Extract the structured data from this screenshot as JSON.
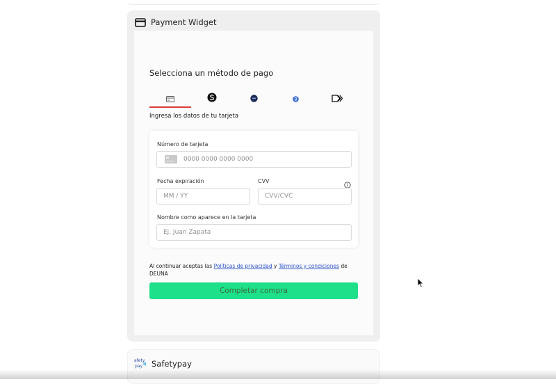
{
  "widget": {
    "title": "Payment Widget",
    "icon": "credit-card-icon"
  },
  "payment": {
    "heading": "Selecciona un método de pago",
    "tabs": [
      {
        "icon": "card-icon",
        "active": true
      },
      {
        "icon": "safetypay-s-icon",
        "active": false
      },
      {
        "icon": "bank-dot-icon",
        "active": false
      },
      {
        "icon": "b-circle-icon",
        "active": false
      },
      {
        "icon": "arrow-forward-icon",
        "active": false
      }
    ],
    "subtitle": "Ingresa los datos de tu tarjeta",
    "active_tab_color": "#e03a3a"
  },
  "form": {
    "card_number": {
      "label": "Número de tarjeta",
      "placeholder": "0000 0000 0000 0000",
      "value": ""
    },
    "expiry": {
      "label": "Fecha expiración",
      "placeholder": "MM / YY",
      "value": ""
    },
    "cvv": {
      "label": "CVV",
      "placeholder": "CVV/CVC",
      "value": "",
      "info_icon": "info-icon"
    },
    "name": {
      "label": "Nombre como aparece en la tarjeta",
      "placeholder": "Ej. Juan Zapata",
      "value": ""
    }
  },
  "terms": {
    "prefix": "Al continuar aceptas las ",
    "privacy_link": "Políticas de privacidad",
    "middle": " y ",
    "terms_link": "Términos y condiciones",
    "suffix": " de DEUNA"
  },
  "submit": {
    "label": "Completar compra",
    "color": "#1ee08a"
  },
  "safetypay": {
    "title": "Safetypay",
    "logo_icon": "safetypay-logo-icon"
  }
}
